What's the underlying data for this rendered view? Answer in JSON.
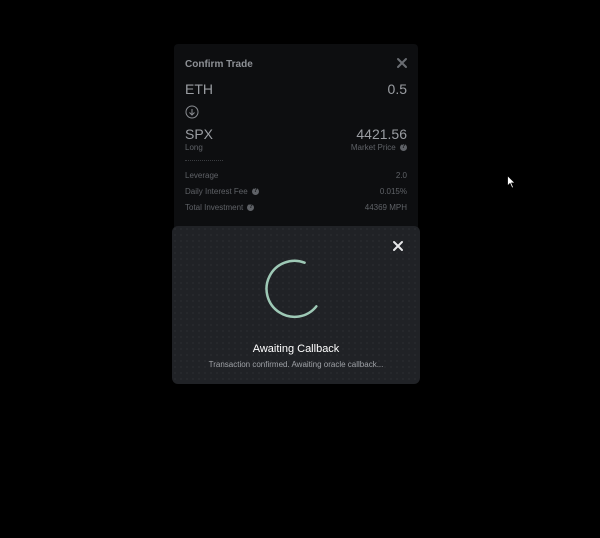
{
  "trade": {
    "title": "Confirm Trade",
    "from_asset": "ETH",
    "from_amount": "0.5",
    "to_asset": "SPX",
    "to_amount": "4421.56",
    "position": "Long",
    "price_label": "Market Price",
    "details": [
      {
        "label": "Leverage",
        "value": "2.0"
      },
      {
        "label": "Daily Interest Fee",
        "value": "0.015%"
      },
      {
        "label": "Total Investment",
        "value": "44369 MPH"
      }
    ]
  },
  "modal": {
    "title": "Awaiting Callback",
    "message": "Transaction confirmed. Awaiting oracle callback...",
    "spinner_color": "#9ec9b6"
  },
  "icons": {
    "trade_close": "close-icon",
    "modal_close": "close-icon",
    "swap": "arrow-down-circle-icon",
    "help": "question-circle-icon",
    "cursor": "mouse-pointer-icon"
  }
}
